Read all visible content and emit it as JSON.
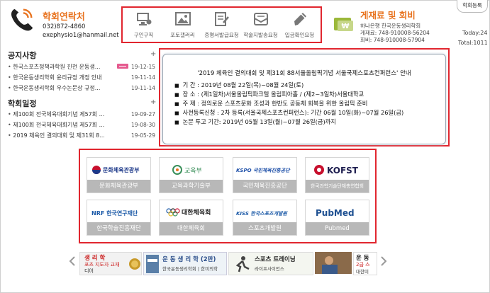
{
  "contact": {
    "title": "학회연락처",
    "phone": "032)872-4860",
    "email": "exephysio1@hanmail.net"
  },
  "quick_links": [
    {
      "label": "구인구직",
      "icon": "monitor-icon"
    },
    {
      "label": "포토갤러리",
      "icon": "photo-icon"
    },
    {
      "label": "증명서발급요청",
      "icon": "certificate-icon"
    },
    {
      "label": "학술지발송요청",
      "icon": "mail-icon"
    },
    {
      "label": "입금확인요청",
      "icon": "pen-icon"
    }
  ],
  "fee": {
    "title": "게재료 및 회비",
    "bank": "하나은행 한국운동생리학회",
    "account1": "게재료: 748-910008-56204",
    "account2": "회비: 748-910008-57904",
    "icon": "won-card-icon"
  },
  "side": {
    "button": "학회등록",
    "today": "Today:24",
    "total": "Total:1011"
  },
  "notices": {
    "title": "공지사항",
    "plus": "+",
    "items": [
      {
        "title": "한국스포츠정책과학원 진천 운동생...",
        "date": "19-12-15",
        "new": true
      },
      {
        "title": "한국운동생리학회 윤리규정 개정 안내",
        "date": "19-11-14",
        "new": false
      },
      {
        "title": "한국운동생리학회 우수논문상 규정...",
        "date": "19-11-14",
        "new": false
      }
    ]
  },
  "schedule": {
    "title": "학회일정",
    "plus": "+",
    "items": [
      {
        "title": "제100회 전국체육대회기념 제57회 ...",
        "date": "19-09-27"
      },
      {
        "title": "제100회 전국체육대회기념 제57회 ...",
        "date": "19-08-30"
      },
      {
        "title": "2019 체육인 결의대회 및 제31회 8...",
        "date": "19-05-29"
      }
    ]
  },
  "popup": {
    "title": "'2019 체육인 결의대회 및 제31회 88서울올림픽기념 서울국제스포츠컨퍼런스' 안내",
    "lines": [
      "기 간 : 2019년 08월 22일(목)~08월 24일(토)",
      "장 소 : (제1일차)서울올림픽파크텔 올림피아홀 / (제2~3일차)서울대학교",
      "주 제 : 정의로운 스포츠문화 조성과 한반도 공동체 회복을 위한 올림픽 준비",
      "사전등록신청 : 2차 등록(서울국제스포츠컨퍼런스): 기간 06월 10일(화)~07월 26일(금)",
      "논문 투고 기간: 2019년 05월 13일(월)~07월 26일(금)까지"
    ]
  },
  "logos": [
    {
      "logo_text": "문화체육관광부",
      "caption": "문화체육관광부",
      "accent": "#1e3a8a"
    },
    {
      "logo_text": "교육부",
      "caption": "교육과학기술부",
      "accent": "#3a8f5a"
    },
    {
      "logo_text": "KSPO 국민체육진흥공단",
      "caption": "국민체육진흥공단",
      "accent": "#1d4fa8"
    },
    {
      "logo_text": "KOFST",
      "caption": "한국과학기술단체총연합회",
      "accent": "#c8102e"
    },
    {
      "logo_text": "NRF 한국연구재단",
      "caption": "한국학술진흥재단",
      "accent": "#1d5ba8"
    },
    {
      "logo_text": "대한체육회",
      "caption": "대한체육회",
      "accent": "#222222"
    },
    {
      "logo_text": "KISS 한국스포츠개발원",
      "caption": "스포츠개발원",
      "accent": "#1d5ba8"
    },
    {
      "logo_text": "PubMed",
      "caption": "Pubmed",
      "accent": "#1d4f91"
    }
  ],
  "banners": [
    {
      "line1": "생 리 학",
      "line2": "포츠 지도자 교재",
      "line3": "디어"
    },
    {
      "line1": "운 동 생 리 학 (2판)",
      "line2": "한국운동생리학회 | 한미의학"
    },
    {
      "line1": "스포츠 트레이닝",
      "line2": "라이프사이언스"
    },
    {
      "line1": "운 동",
      "line2": "2급 스",
      "line3": "대한미"
    }
  ]
}
